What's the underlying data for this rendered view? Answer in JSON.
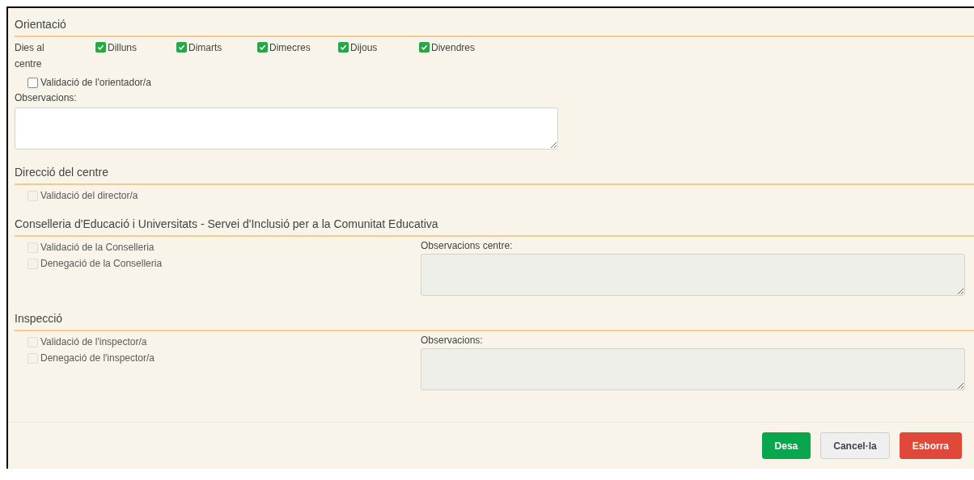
{
  "sections": [
    {
      "title": "Orientació",
      "days": {
        "label": "Dies al centre",
        "items": [
          {
            "label": "Dilluns",
            "checked": true
          },
          {
            "label": "Dimarts",
            "checked": true
          },
          {
            "label": "Dimecres",
            "checked": true
          },
          {
            "label": "Dijous",
            "checked": true
          },
          {
            "label": "Divendres",
            "checked": true
          }
        ]
      },
      "checks": [
        {
          "label": "Validació de l'orientador/a",
          "checked": false,
          "disabled": false
        }
      ],
      "notes": {
        "label": "Observacions:",
        "disabled": false,
        "kind": "stacked"
      }
    },
    {
      "title": "Direcció del centre",
      "checks": [
        {
          "label": "Validació del director/a",
          "checked": false,
          "disabled": true
        }
      ]
    },
    {
      "title": "Conselleria d'Educació i Universitats - Servei d'Inclusió per a la Comunitat Educativa",
      "checks": [
        {
          "label": "Validació de la Conselleria",
          "checked": false,
          "disabled": true
        },
        {
          "label": "Denegació de la Conselleria",
          "checked": false,
          "disabled": true
        }
      ],
      "notes": {
        "label": "Observacions centre:",
        "disabled": true,
        "kind": "side"
      }
    },
    {
      "title": "Inspecció",
      "checks": [
        {
          "label": "Validació de l'inspector/a",
          "checked": false,
          "disabled": true
        },
        {
          "label": "Denegació de l'inspector/a",
          "checked": false,
          "disabled": true
        }
      ],
      "notes": {
        "label": "Observacions:",
        "disabled": true,
        "kind": "side"
      }
    }
  ],
  "buttons": [
    {
      "label": "Desa",
      "kind": "primary"
    },
    {
      "label": "Cancel·la",
      "kind": "default"
    },
    {
      "label": "Esborra",
      "kind": "danger"
    }
  ]
}
